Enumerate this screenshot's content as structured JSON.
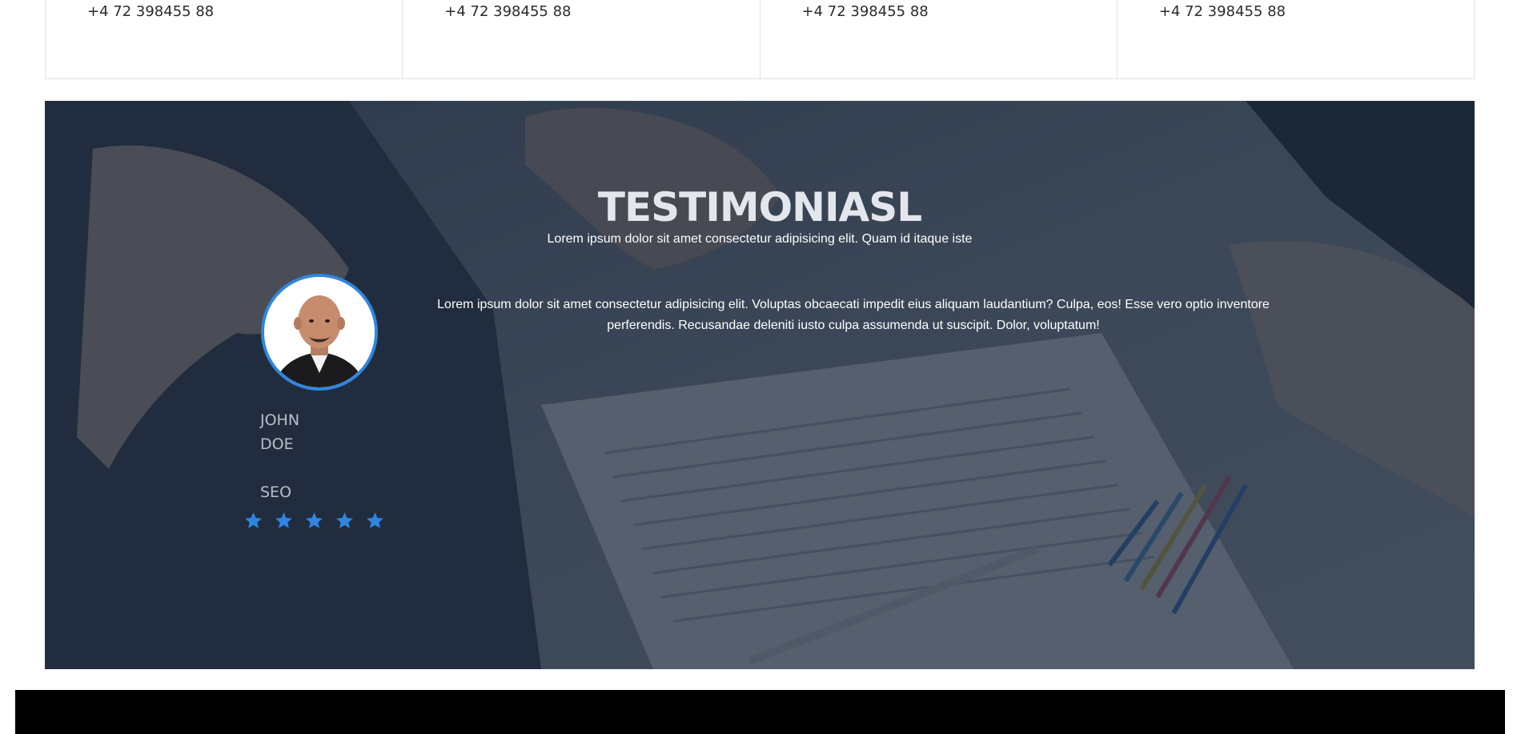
{
  "contacts": [
    {
      "phone": "+4 72 398455 88"
    },
    {
      "phone": "+4 72 398455 88"
    },
    {
      "phone": "+4 72 398455 88"
    },
    {
      "phone": "+4 72 398455 88"
    }
  ],
  "testimonials": {
    "title": "TESTIMONIASL",
    "subtitle": "Lorem ipsum dolor sit amet consectetur adipisicing elit. Quam id itaque iste",
    "items": [
      {
        "first_name": "JOHN",
        "last_name": "DOE",
        "role": "SEO",
        "rating": 5,
        "quote": "Lorem ipsum dolor sit amet consectetur adipisicing elit. Voluptas obcaecati impedit eius aliquam laudantium? Culpa, eos! Esse vero optio inventore perferendis. Recusandae deleniti iusto culpa assumenda ut suscipit. Dolor, voluptatum!",
        "avatar_icon": "person-photo-icon"
      }
    ],
    "background_image": "business-handshake-contract-photo"
  },
  "colors": {
    "accent": "#2f86e0",
    "overlay": "#1c283a",
    "footer": "#000000"
  }
}
